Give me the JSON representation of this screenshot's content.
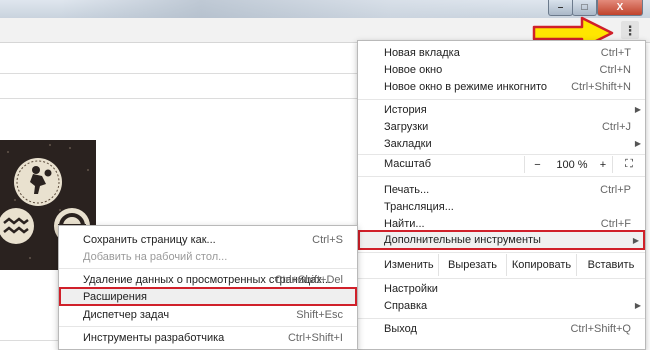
{
  "window": {
    "minimize_glyph": "–",
    "maximize_glyph": "□",
    "close_glyph": "X"
  },
  "toolbar": {
    "menu_glyph": "⋮"
  },
  "menu": {
    "new_tab": {
      "label": "Новая вкладка",
      "shortcut": "Ctrl+T"
    },
    "new_window": {
      "label": "Новое окно",
      "shortcut": "Ctrl+N"
    },
    "incognito": {
      "label": "Новое окно в режиме инкогнито",
      "shortcut": "Ctrl+Shift+N"
    },
    "history": {
      "label": "История",
      "arrow": "▶"
    },
    "downloads": {
      "label": "Загрузки",
      "shortcut": "Ctrl+J"
    },
    "bookmarks": {
      "label": "Закладки",
      "arrow": "▶"
    },
    "zoom": {
      "label": "Масштаб",
      "minus": "−",
      "value": "100 %",
      "plus": "+",
      "fullscreen": "⛶"
    },
    "print": {
      "label": "Печать...",
      "shortcut": "Ctrl+P"
    },
    "cast": {
      "label": "Трансляция..."
    },
    "find": {
      "label": "Найти...",
      "shortcut": "Ctrl+F"
    },
    "more_tools": {
      "label": "Дополнительные инструменты",
      "arrow": "▶"
    },
    "edit": {
      "label": "Изменить",
      "cut": "Вырезать",
      "copy": "Копировать",
      "paste": "Вставить"
    },
    "settings": {
      "label": "Настройки"
    },
    "help": {
      "label": "Справка",
      "arrow": "▶"
    },
    "exit": {
      "label": "Выход",
      "shortcut": "Ctrl+Shift+Q"
    }
  },
  "submenu": {
    "save_page": {
      "label": "Сохранить страницу как...",
      "shortcut": "Ctrl+S"
    },
    "add_to_desktop": {
      "label": "Добавить на рабочий стол..."
    },
    "clear_data": {
      "label": "Удаление данных о просмотренных страницах...",
      "shortcut": "Ctrl+Shift+Del"
    },
    "extensions": {
      "label": "Расширения"
    },
    "task_manager": {
      "label": "Диспетчер задач",
      "shortcut": "Shift+Esc"
    },
    "dev_tools": {
      "label": "Инструменты разработчика",
      "shortcut": "Ctrl+Shift+I"
    }
  },
  "colors": {
    "highlight_border": "#d0202a",
    "arrow_fill": "#ffe600",
    "arrow_stroke": "#d0202a"
  }
}
